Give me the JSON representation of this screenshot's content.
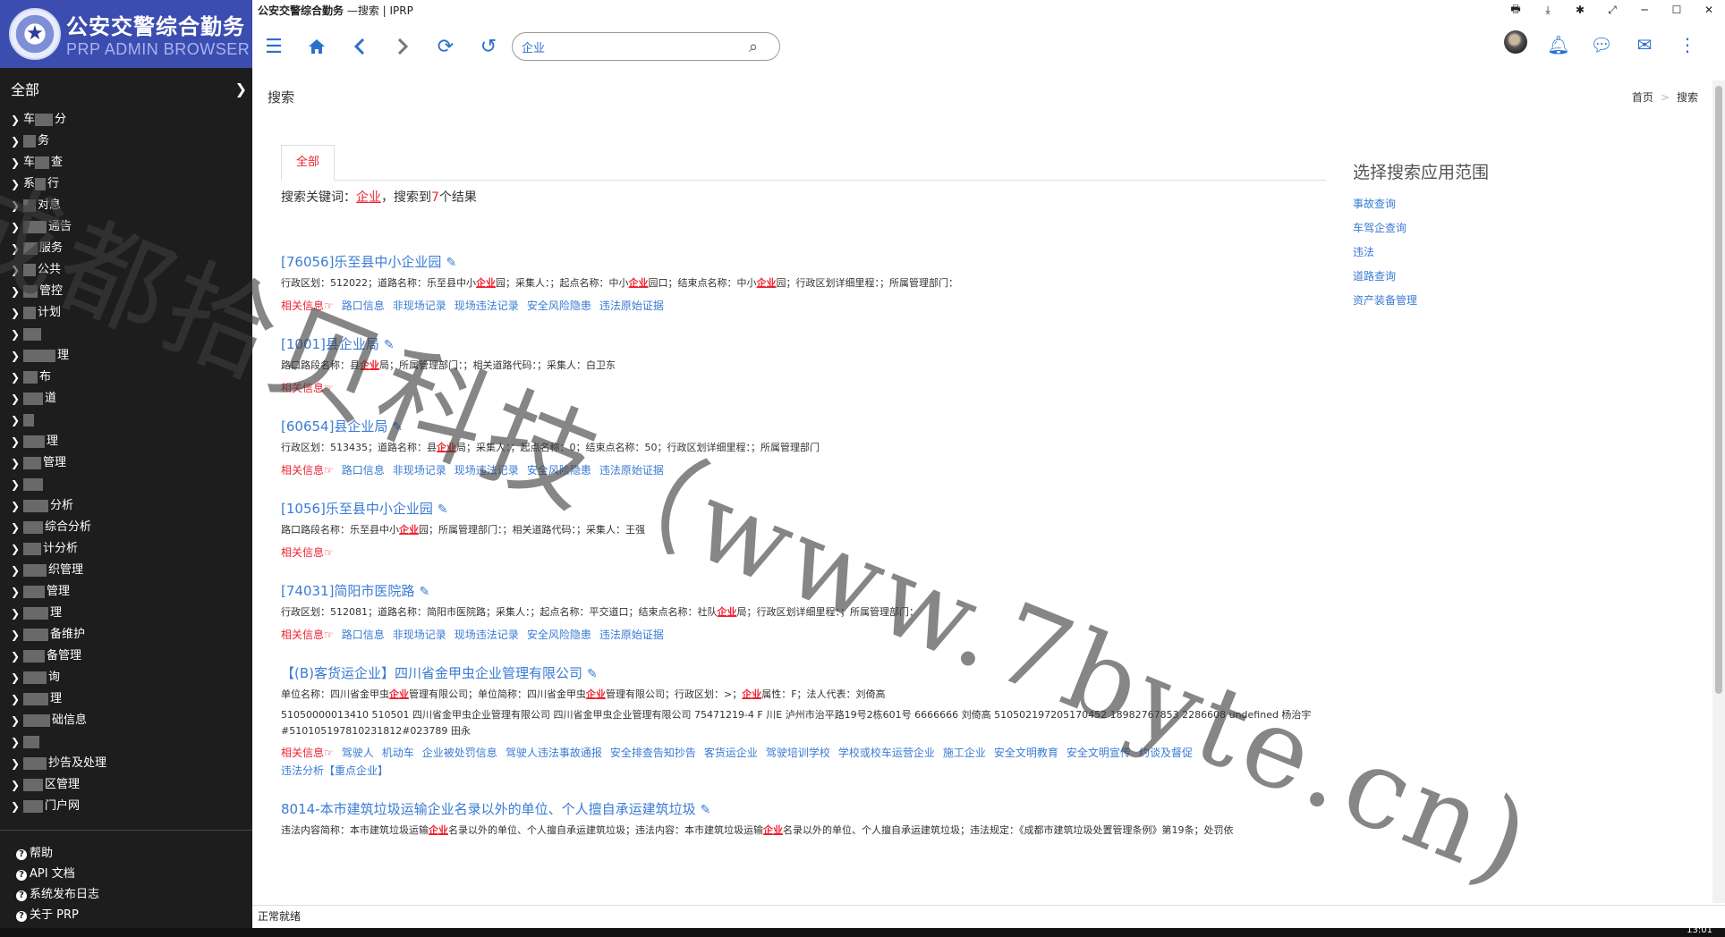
{
  "window": {
    "title_bold": "公安交警综合勤务",
    "title_rest": " —搜索 | IPRP",
    "controls": [
      "🖶",
      "⤓",
      "✱",
      "⤢",
      "─",
      "☐",
      "✕"
    ]
  },
  "brand": {
    "name": "公安交警综合勤务",
    "subtitle": "PRP ADMIN BROWSER"
  },
  "sidebar": {
    "header": "全部",
    "items": [
      {
        "pre": "车",
        "post": "分"
      },
      {
        "pre": "",
        "post": "务"
      },
      {
        "pre": "车",
        "post": "查"
      },
      {
        "pre": "系",
        "post": "行"
      },
      {
        "pre": "",
        "post": "对息"
      },
      {
        "pre": "",
        "post": "通告"
      },
      {
        "pre": "",
        "post": "服务"
      },
      {
        "pre": "",
        "post": "公共"
      },
      {
        "pre": "",
        "post": "管控"
      },
      {
        "pre": "",
        "post": "计划"
      },
      {
        "pre": "",
        "post": ""
      },
      {
        "pre": "",
        "post": "理"
      },
      {
        "pre": "",
        "post": "布"
      },
      {
        "pre": "",
        "post": "道"
      },
      {
        "pre": "",
        "post": ""
      },
      {
        "pre": "",
        "post": "理"
      },
      {
        "pre": "",
        "post": "管理"
      },
      {
        "pre": "",
        "post": ""
      },
      {
        "pre": "",
        "post": "分析"
      },
      {
        "pre": "",
        "post": "综合分析"
      },
      {
        "pre": "",
        "post": "计分析"
      },
      {
        "pre": "",
        "post": "织管理"
      },
      {
        "pre": "",
        "post": "管理"
      },
      {
        "pre": "",
        "post": "理"
      },
      {
        "pre": "",
        "post": "备维护"
      },
      {
        "pre": "",
        "post": "备管理"
      },
      {
        "pre": "",
        "post": "询"
      },
      {
        "pre": "",
        "post": "理"
      },
      {
        "pre": "",
        "post": "础信息"
      },
      {
        "pre": "",
        "post": ""
      },
      {
        "pre": "",
        "post": "抄告及处理"
      },
      {
        "pre": "",
        "post": "区管理"
      },
      {
        "pre": "",
        "post": "门户网"
      }
    ],
    "bottom_links": [
      "帮助",
      "API 文档",
      "系统发布日志",
      "关于 PRP"
    ]
  },
  "toolbar": {
    "search_value": "企业"
  },
  "page": {
    "title": "搜索",
    "breadcrumb": [
      "首页",
      "搜索"
    ]
  },
  "tabs": [
    "全部"
  ],
  "summary": {
    "prefix": "搜索关键词：",
    "keyword": "企业",
    "middle": "，搜索到",
    "count": "7",
    "suffix": "个结果"
  },
  "results": [
    {
      "title": "[76056]乐至县中小企业园",
      "lines": [
        [
          {
            "t": "行政区划：512022；道路名称：乐至县中小"
          },
          {
            "t": "企业",
            "hl": true
          },
          {
            "t": "园；采集人：；起点名称：中小"
          },
          {
            "t": "企业",
            "hl": true
          },
          {
            "t": "园口；结束点名称：中小"
          },
          {
            "t": "企业",
            "hl": true
          },
          {
            "t": "园；行政区划详细里程：；所属管理部门："
          }
        ]
      ],
      "links": [
        "相关信息☞",
        "路口信息",
        "非现场记录",
        "现场违法记录",
        "安全风险隐患",
        "违法原始证据"
      ]
    },
    {
      "title": "[1001]县企业局",
      "lines": [
        [
          {
            "t": "路口路段名称：县"
          },
          {
            "t": "企业",
            "hl": true
          },
          {
            "t": "局；所属管理部门：；相关道路代码：；采集人：白卫东"
          }
        ]
      ],
      "links": [
        "相关信息☞"
      ]
    },
    {
      "title": "[60654]县企业局",
      "lines": [
        [
          {
            "t": "行政区划：513435；道路名称：县"
          },
          {
            "t": "企业",
            "hl": true
          },
          {
            "t": "局；采集人：；起点名称：0；结束点名称：50；行政区划详细里程：；所属管理部门"
          }
        ]
      ],
      "links": [
        "相关信息☞",
        "路口信息",
        "非现场记录",
        "现场违法记录",
        "安全风险隐患",
        "违法原始证据"
      ]
    },
    {
      "title": "[1056]乐至县中小企业园",
      "lines": [
        [
          {
            "t": "路口路段名称：乐至县中小"
          },
          {
            "t": "企业",
            "hl": true
          },
          {
            "t": "园；所属管理部门：；相关道路代码：；采集人：王强"
          }
        ]
      ],
      "links": [
        "相关信息☞"
      ]
    },
    {
      "title": "[74031]简阳市医院路",
      "lines": [
        [
          {
            "t": "行政区划：512081；道路名称：简阳市医院路；采集人：；起点名称：平交道口；结束点名称：社队"
          },
          {
            "t": "企业",
            "hl": true
          },
          {
            "t": "局；行政区划详细里程：；所属管理部门："
          }
        ]
      ],
      "links": [
        "相关信息☞",
        "路口信息",
        "非现场记录",
        "现场违法记录",
        "安全风险隐患",
        "违法原始证据"
      ]
    },
    {
      "title": "【(B)客货运企业】四川省金甲虫企业管理有限公司",
      "lines": [
        [
          {
            "t": "单位名称：四川省金甲虫"
          },
          {
            "t": "企业",
            "hl": true
          },
          {
            "t": "管理有限公司；单位简称：四川省金甲虫"
          },
          {
            "t": "企业",
            "hl": true
          },
          {
            "t": "管理有限公司；行政区划：>；"
          },
          {
            "t": "企业",
            "hl": true
          },
          {
            "t": "属性：F；法人代表：刘倚高"
          }
        ]
      ],
      "raw": [
        {
          "t": "51050000013410 510501 四川省金甲虫"
        },
        {
          "t": "企业",
          "hl": true
        },
        {
          "t": "管理有限公司 四川省金甲虫"
        },
        {
          "t": "企业",
          "hl": true
        },
        {
          "t": "管理有限公司 75471219-4 F 川E 泸州市治平路19号2栋601号 6666666 刘倚高 510502197205170452 18982767853 2286608 undefined 杨治宇 #510105197810231812#023789 田永"
        }
      ],
      "links": [
        "相关信息☞",
        "驾驶人",
        "机动车",
        "企业被处罚信息",
        "驾驶人违法事故通报",
        "安全排查告知抄告",
        "客货运企业",
        "驾驶培训学校",
        "学校或校车运营企业",
        "施工企业",
        "安全文明教育",
        "安全文明宣传",
        "约谈及督促",
        "违法分析【重点企业】"
      ]
    },
    {
      "title": "8014-本市建筑垃圾运输企业名录以外的单位、个人擅自承运建筑垃圾",
      "lines": [
        [
          {
            "t": "违法内容简称：本市建筑垃圾运输"
          },
          {
            "t": "企业",
            "hl": true
          },
          {
            "t": "名录以外的单位、个人擅自承运建筑垃圾；违法内容：本市建筑垃圾运输"
          },
          {
            "t": "企业",
            "hl": true
          },
          {
            "t": "名录以外的单位、个人擅自承运建筑垃圾；违法规定：《成都市建筑垃圾处置管理条例》第19条；处罚依"
          }
        ]
      ],
      "links": []
    }
  ],
  "side_panel": {
    "title": "选择搜索应用范围",
    "links": [
      "事故查询",
      "车驾企查询",
      "违法",
      "道路查询",
      "资产装备管理"
    ]
  },
  "status": "正常就绪",
  "taskbar_clock": "13:01",
  "watermark": "成都拾贝科技（www.7byte.cn)",
  "colors": {
    "brand_bg": "#3c4db0",
    "sidebar_bg": "#1d1d1d",
    "accent": "#3a7bd5",
    "highlight": "#e23"
  }
}
